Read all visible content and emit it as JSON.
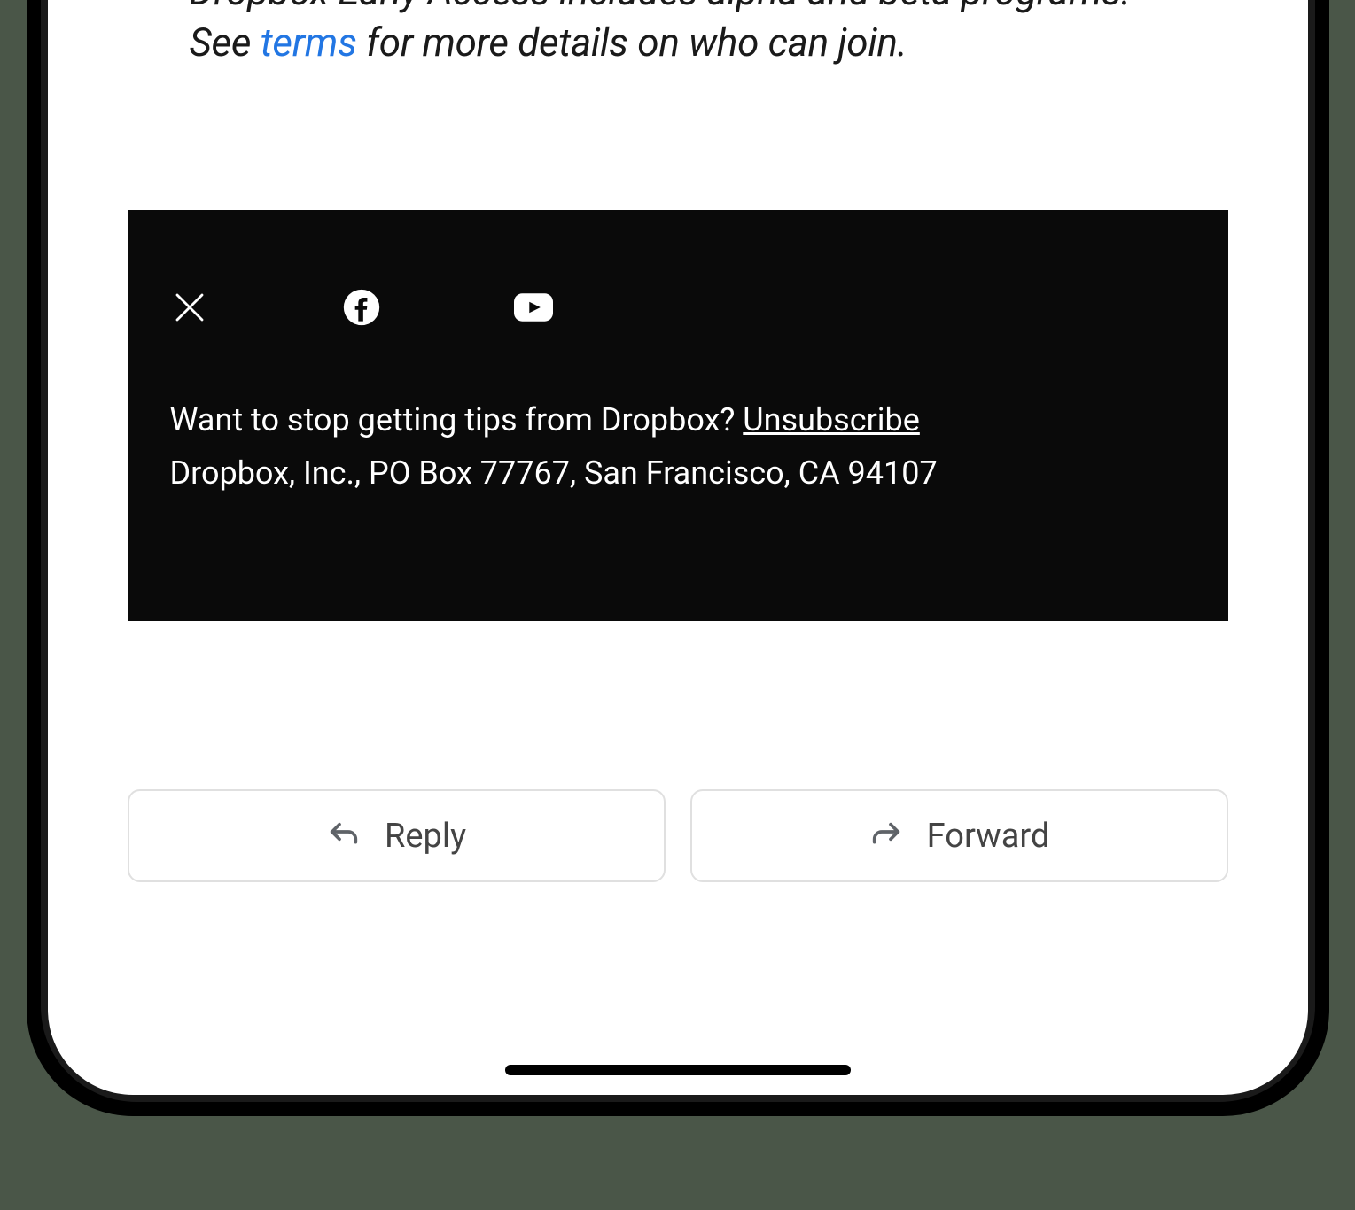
{
  "body": {
    "text_before_link": "Dropbox Early Access includes alpha and beta programs. See ",
    "terms_link": "terms",
    "text_after_link": " for more details on who can join."
  },
  "footer": {
    "question": "Want to stop getting tips from Dropbox? ",
    "unsubscribe": "Unsubscribe",
    "address": "Dropbox, Inc., PO Box 77767, San Francisco, CA 94107"
  },
  "actions": {
    "reply": "Reply",
    "forward": "Forward"
  },
  "icons": {
    "x": "x-twitter-icon",
    "facebook": "facebook-icon",
    "youtube": "youtube-icon"
  }
}
